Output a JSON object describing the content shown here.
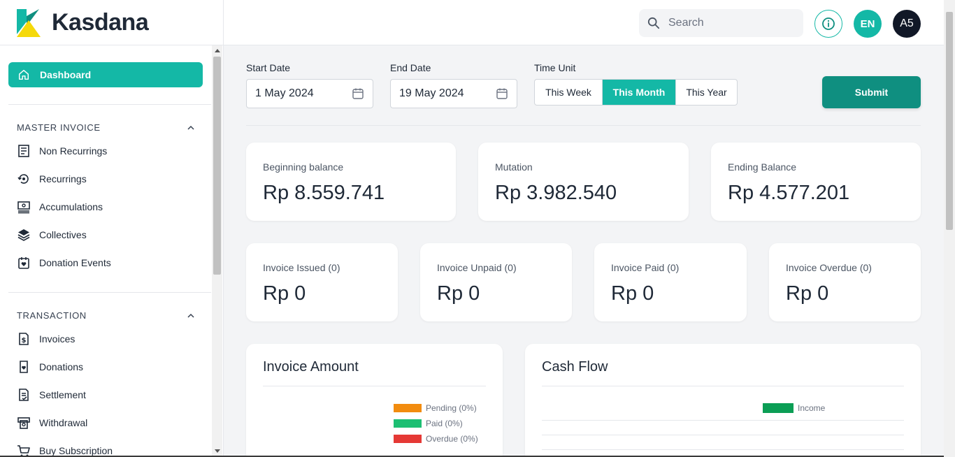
{
  "app": {
    "name": "Kasdana"
  },
  "header": {
    "search_placeholder": "Search",
    "lang": "EN",
    "avatar": "A5",
    "icons": [
      "search-icon",
      "info-icon"
    ]
  },
  "sidebar": {
    "dashboard": "Dashboard",
    "sections": [
      {
        "title": "MASTER INVOICE",
        "items": [
          {
            "label": "Non Recurrings",
            "icon": "receipt-icon"
          },
          {
            "label": "Recurrings",
            "icon": "recurring-icon"
          },
          {
            "label": "Accumulations",
            "icon": "accumulation-icon"
          },
          {
            "label": "Collectives",
            "icon": "layers-icon"
          },
          {
            "label": "Donation Events",
            "icon": "calendar-heart-icon"
          }
        ]
      },
      {
        "title": "TRANSACTION",
        "items": [
          {
            "label": "Invoices",
            "icon": "invoice-dollar-icon"
          },
          {
            "label": "Donations",
            "icon": "donation-icon"
          },
          {
            "label": "Settlement",
            "icon": "settlement-icon"
          },
          {
            "label": "Withdrawal",
            "icon": "withdrawal-icon"
          },
          {
            "label": "Buy Subscription",
            "icon": "cart-icon"
          }
        ]
      }
    ]
  },
  "filters": {
    "start_label": "Start Date",
    "start_value": "1 May 2024",
    "end_label": "End Date",
    "end_value": "19 May 2024",
    "unit_label": "Time Unit",
    "units": [
      "This Week",
      "This Month",
      "This Year"
    ],
    "active_unit": "This Month",
    "submit": "Submit"
  },
  "balances": [
    {
      "label": "Beginning balance",
      "value": "Rp 8.559.741"
    },
    {
      "label": "Mutation",
      "value": "Rp 3.982.540"
    },
    {
      "label": "Ending Balance",
      "value": "Rp 4.577.201"
    }
  ],
  "invoices": [
    {
      "label": "Invoice Issued (0)",
      "value": "Rp 0"
    },
    {
      "label": "Invoice Unpaid (0)",
      "value": "Rp 0"
    },
    {
      "label": "Invoice Paid (0)",
      "value": "Rp 0"
    },
    {
      "label": "Invoice Overdue (0)",
      "value": "Rp 0"
    }
  ],
  "invoice_amount": {
    "title": "Invoice Amount",
    "legend": [
      {
        "label": "Pending (0%)",
        "color": "#f28c0f"
      },
      {
        "label": "Paid (0%)",
        "color": "#1dbf73"
      },
      {
        "label": "Overdue (0%)",
        "color": "#e53935"
      }
    ]
  },
  "cash_flow": {
    "title": "Cash Flow",
    "legend": [
      {
        "label": "Income",
        "color": "#0b9e55"
      }
    ]
  },
  "colors": {
    "primary": "#14b8a6",
    "submit": "#0f8f80",
    "dark": "#111827"
  }
}
